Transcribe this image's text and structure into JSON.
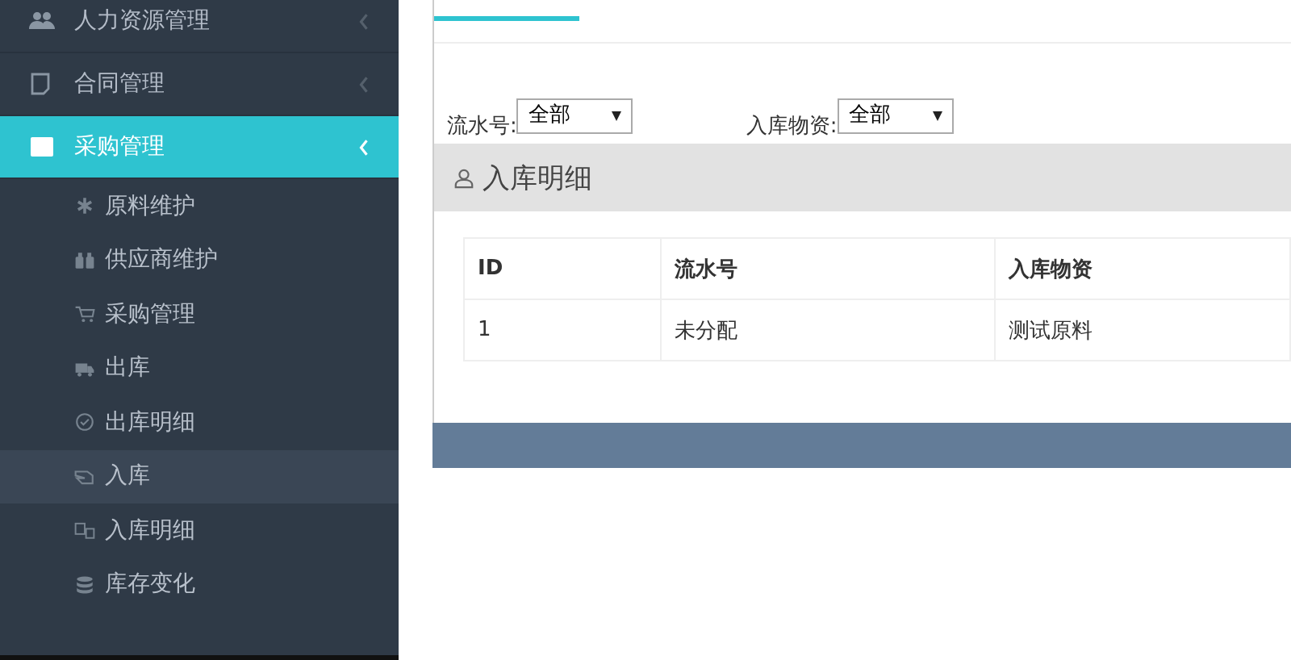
{
  "sidebar": {
    "items": [
      {
        "label": "人力资源管理",
        "selected": false
      },
      {
        "label": "合同管理",
        "selected": false
      },
      {
        "label": "采购管理",
        "selected": true,
        "children": [
          {
            "label": "原料维护",
            "selected": false
          },
          {
            "label": "供应商维护",
            "selected": false
          },
          {
            "label": "采购管理",
            "selected": false
          },
          {
            "label": "出库",
            "selected": false
          },
          {
            "label": "出库明细",
            "selected": false
          },
          {
            "label": "入库",
            "selected": true
          },
          {
            "label": "入库明细",
            "selected": false
          },
          {
            "label": "库存变化",
            "selected": false
          }
        ]
      }
    ]
  },
  "filters": [
    {
      "label": "流水号:",
      "value": "全部"
    },
    {
      "label": "入库物资:",
      "value": "全部"
    }
  ],
  "panel": {
    "title": "入库明细"
  },
  "table": {
    "columns": [
      "ID",
      "流水号",
      "入库物资"
    ],
    "rows": [
      [
        "1",
        "未分配",
        "测试原料"
      ]
    ]
  }
}
